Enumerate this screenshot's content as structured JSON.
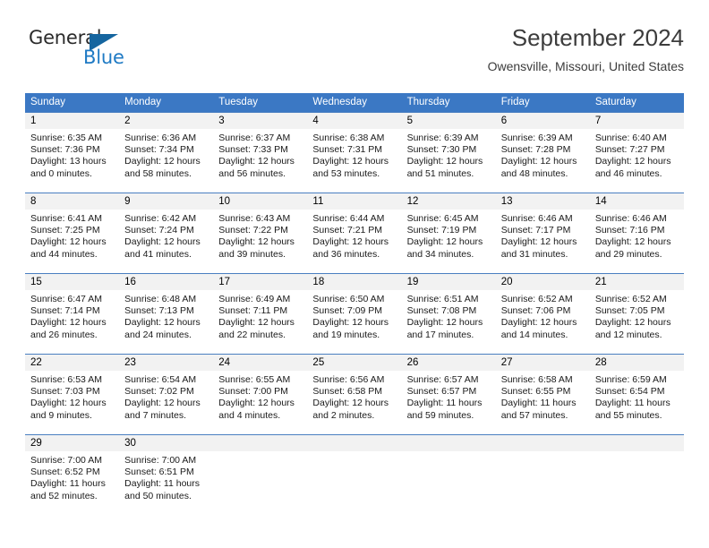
{
  "brand": {
    "name_top": "General",
    "name_bottom": "Blue",
    "accent_color": "#1f7ac4",
    "triangle_color": "#15659f",
    "logo_icon": "triangle-flag-icon"
  },
  "header": {
    "title": "September 2024",
    "subtitle": "Owensville, Missouri, United States"
  },
  "calendar": {
    "header_bg": "#3b78c4",
    "daynum_bg": "#f2f2f2",
    "row_divider": "#4a7fc1",
    "weekdays": [
      "Sunday",
      "Monday",
      "Tuesday",
      "Wednesday",
      "Thursday",
      "Friday",
      "Saturday"
    ],
    "weeks": [
      [
        {
          "day": "1",
          "sunrise": "Sunrise: 6:35 AM",
          "sunset": "Sunset: 7:36 PM",
          "daylight1": "Daylight: 13 hours",
          "daylight2": "and 0 minutes."
        },
        {
          "day": "2",
          "sunrise": "Sunrise: 6:36 AM",
          "sunset": "Sunset: 7:34 PM",
          "daylight1": "Daylight: 12 hours",
          "daylight2": "and 58 minutes."
        },
        {
          "day": "3",
          "sunrise": "Sunrise: 6:37 AM",
          "sunset": "Sunset: 7:33 PM",
          "daylight1": "Daylight: 12 hours",
          "daylight2": "and 56 minutes."
        },
        {
          "day": "4",
          "sunrise": "Sunrise: 6:38 AM",
          "sunset": "Sunset: 7:31 PM",
          "daylight1": "Daylight: 12 hours",
          "daylight2": "and 53 minutes."
        },
        {
          "day": "5",
          "sunrise": "Sunrise: 6:39 AM",
          "sunset": "Sunset: 7:30 PM",
          "daylight1": "Daylight: 12 hours",
          "daylight2": "and 51 minutes."
        },
        {
          "day": "6",
          "sunrise": "Sunrise: 6:39 AM",
          "sunset": "Sunset: 7:28 PM",
          "daylight1": "Daylight: 12 hours",
          "daylight2": "and 48 minutes."
        },
        {
          "day": "7",
          "sunrise": "Sunrise: 6:40 AM",
          "sunset": "Sunset: 7:27 PM",
          "daylight1": "Daylight: 12 hours",
          "daylight2": "and 46 minutes."
        }
      ],
      [
        {
          "day": "8",
          "sunrise": "Sunrise: 6:41 AM",
          "sunset": "Sunset: 7:25 PM",
          "daylight1": "Daylight: 12 hours",
          "daylight2": "and 44 minutes."
        },
        {
          "day": "9",
          "sunrise": "Sunrise: 6:42 AM",
          "sunset": "Sunset: 7:24 PM",
          "daylight1": "Daylight: 12 hours",
          "daylight2": "and 41 minutes."
        },
        {
          "day": "10",
          "sunrise": "Sunrise: 6:43 AM",
          "sunset": "Sunset: 7:22 PM",
          "daylight1": "Daylight: 12 hours",
          "daylight2": "and 39 minutes."
        },
        {
          "day": "11",
          "sunrise": "Sunrise: 6:44 AM",
          "sunset": "Sunset: 7:21 PM",
          "daylight1": "Daylight: 12 hours",
          "daylight2": "and 36 minutes."
        },
        {
          "day": "12",
          "sunrise": "Sunrise: 6:45 AM",
          "sunset": "Sunset: 7:19 PM",
          "daylight1": "Daylight: 12 hours",
          "daylight2": "and 34 minutes."
        },
        {
          "day": "13",
          "sunrise": "Sunrise: 6:46 AM",
          "sunset": "Sunset: 7:17 PM",
          "daylight1": "Daylight: 12 hours",
          "daylight2": "and 31 minutes."
        },
        {
          "day": "14",
          "sunrise": "Sunrise: 6:46 AM",
          "sunset": "Sunset: 7:16 PM",
          "daylight1": "Daylight: 12 hours",
          "daylight2": "and 29 minutes."
        }
      ],
      [
        {
          "day": "15",
          "sunrise": "Sunrise: 6:47 AM",
          "sunset": "Sunset: 7:14 PM",
          "daylight1": "Daylight: 12 hours",
          "daylight2": "and 26 minutes."
        },
        {
          "day": "16",
          "sunrise": "Sunrise: 6:48 AM",
          "sunset": "Sunset: 7:13 PM",
          "daylight1": "Daylight: 12 hours",
          "daylight2": "and 24 minutes."
        },
        {
          "day": "17",
          "sunrise": "Sunrise: 6:49 AM",
          "sunset": "Sunset: 7:11 PM",
          "daylight1": "Daylight: 12 hours",
          "daylight2": "and 22 minutes."
        },
        {
          "day": "18",
          "sunrise": "Sunrise: 6:50 AM",
          "sunset": "Sunset: 7:09 PM",
          "daylight1": "Daylight: 12 hours",
          "daylight2": "and 19 minutes."
        },
        {
          "day": "19",
          "sunrise": "Sunrise: 6:51 AM",
          "sunset": "Sunset: 7:08 PM",
          "daylight1": "Daylight: 12 hours",
          "daylight2": "and 17 minutes."
        },
        {
          "day": "20",
          "sunrise": "Sunrise: 6:52 AM",
          "sunset": "Sunset: 7:06 PM",
          "daylight1": "Daylight: 12 hours",
          "daylight2": "and 14 minutes."
        },
        {
          "day": "21",
          "sunrise": "Sunrise: 6:52 AM",
          "sunset": "Sunset: 7:05 PM",
          "daylight1": "Daylight: 12 hours",
          "daylight2": "and 12 minutes."
        }
      ],
      [
        {
          "day": "22",
          "sunrise": "Sunrise: 6:53 AM",
          "sunset": "Sunset: 7:03 PM",
          "daylight1": "Daylight: 12 hours",
          "daylight2": "and 9 minutes."
        },
        {
          "day": "23",
          "sunrise": "Sunrise: 6:54 AM",
          "sunset": "Sunset: 7:02 PM",
          "daylight1": "Daylight: 12 hours",
          "daylight2": "and 7 minutes."
        },
        {
          "day": "24",
          "sunrise": "Sunrise: 6:55 AM",
          "sunset": "Sunset: 7:00 PM",
          "daylight1": "Daylight: 12 hours",
          "daylight2": "and 4 minutes."
        },
        {
          "day": "25",
          "sunrise": "Sunrise: 6:56 AM",
          "sunset": "Sunset: 6:58 PM",
          "daylight1": "Daylight: 12 hours",
          "daylight2": "and 2 minutes."
        },
        {
          "day": "26",
          "sunrise": "Sunrise: 6:57 AM",
          "sunset": "Sunset: 6:57 PM",
          "daylight1": "Daylight: 11 hours",
          "daylight2": "and 59 minutes."
        },
        {
          "day": "27",
          "sunrise": "Sunrise: 6:58 AM",
          "sunset": "Sunset: 6:55 PM",
          "daylight1": "Daylight: 11 hours",
          "daylight2": "and 57 minutes."
        },
        {
          "day": "28",
          "sunrise": "Sunrise: 6:59 AM",
          "sunset": "Sunset: 6:54 PM",
          "daylight1": "Daylight: 11 hours",
          "daylight2": "and 55 minutes."
        }
      ],
      [
        {
          "day": "29",
          "sunrise": "Sunrise: 7:00 AM",
          "sunset": "Sunset: 6:52 PM",
          "daylight1": "Daylight: 11 hours",
          "daylight2": "and 52 minutes."
        },
        {
          "day": "30",
          "sunrise": "Sunrise: 7:00 AM",
          "sunset": "Sunset: 6:51 PM",
          "daylight1": "Daylight: 11 hours",
          "daylight2": "and 50 minutes."
        },
        {
          "day": "",
          "sunrise": "",
          "sunset": "",
          "daylight1": "",
          "daylight2": ""
        },
        {
          "day": "",
          "sunrise": "",
          "sunset": "",
          "daylight1": "",
          "daylight2": ""
        },
        {
          "day": "",
          "sunrise": "",
          "sunset": "",
          "daylight1": "",
          "daylight2": ""
        },
        {
          "day": "",
          "sunrise": "",
          "sunset": "",
          "daylight1": "",
          "daylight2": ""
        },
        {
          "day": "",
          "sunrise": "",
          "sunset": "",
          "daylight1": "",
          "daylight2": ""
        }
      ]
    ]
  }
}
